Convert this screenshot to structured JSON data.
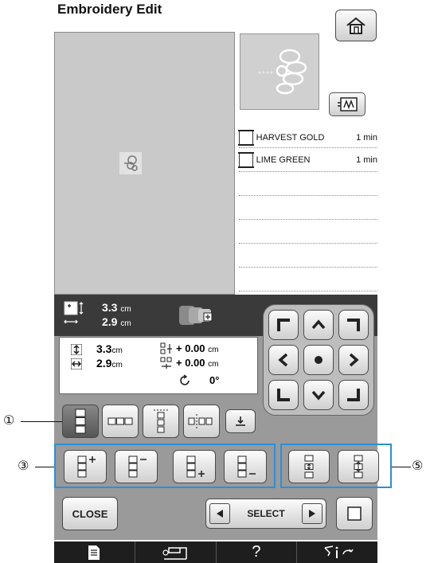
{
  "header": {
    "title": "Embroidery Edit"
  },
  "threads": [
    {
      "name": "HARVEST GOLD",
      "time": "1 min"
    },
    {
      "name": "LIME GREEN",
      "time": "1 min"
    }
  ],
  "size_summary": {
    "height": "3.3",
    "width": "2.9",
    "unit": "cm"
  },
  "info": {
    "height": "3.3",
    "width": "2.9",
    "unit": "cm",
    "offset_y": "+ 0.00",
    "offset_x": "+ 0.00",
    "offset_unit": "cm",
    "rotation": "0°"
  },
  "bottom_row": {
    "close_label": "CLOSE",
    "select_label": "SELECT"
  },
  "callouts": {
    "c1": "①",
    "c3": "③",
    "c5": "⑤"
  },
  "colors": {
    "accent_frame": "#2c8fd6",
    "panel": "#9a9a9a",
    "dark_bar": "#3a3a3a"
  }
}
